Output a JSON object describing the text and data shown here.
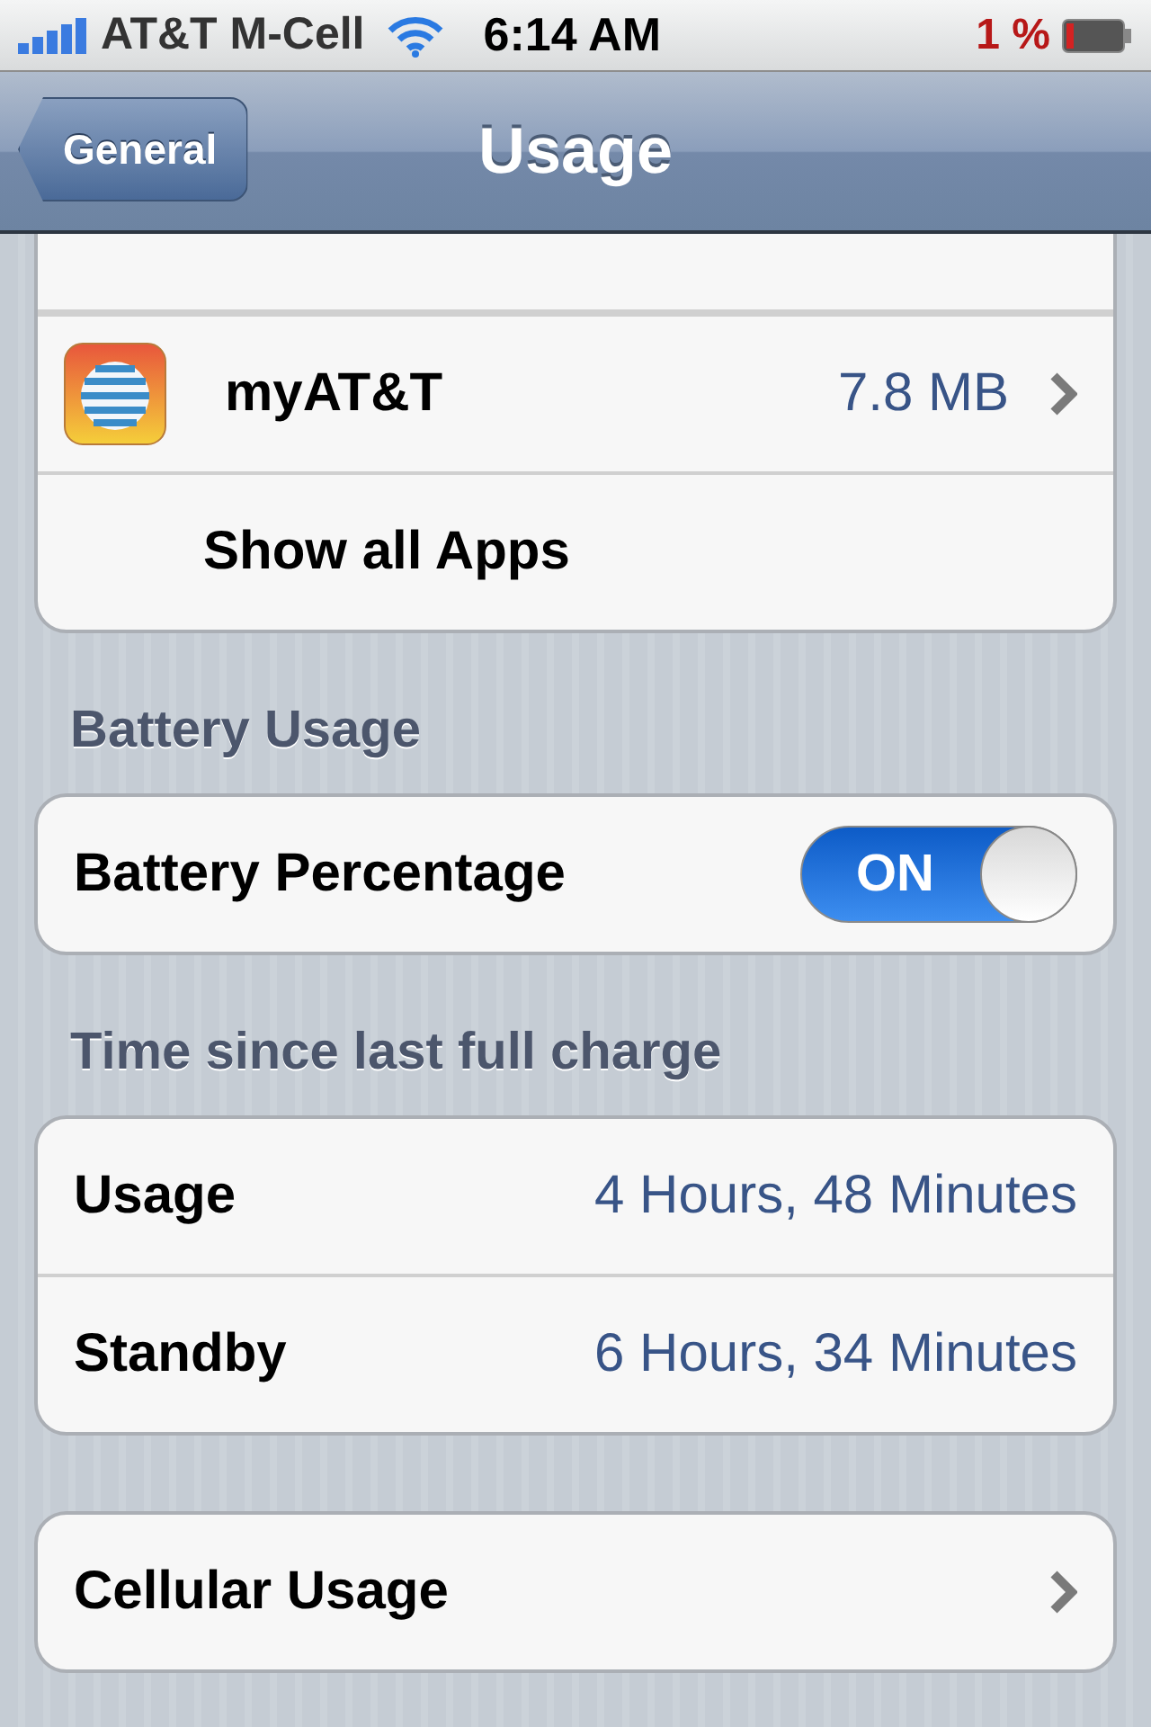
{
  "status_bar": {
    "carrier": "AT&T M-Cell",
    "time": "6:14 AM",
    "battery_percent": "1 %"
  },
  "nav_bar": {
    "back": "General",
    "title": "Usage"
  },
  "sections": [
    {
      "rows": [
        {
          "kind": "app",
          "label": "myAT&T",
          "value": "7.8 MB",
          "chevron": true
        },
        {
          "kind": "plain",
          "label": "Show all Apps"
        }
      ]
    },
    {
      "header": "Battery Usage",
      "rows": [
        {
          "kind": "toggle",
          "label": "Battery Percentage",
          "on": true,
          "toggle_text": "ON"
        }
      ]
    },
    {
      "header": "Time since last full charge",
      "rows": [
        {
          "kind": "value",
          "label": "Usage",
          "value": "4 Hours, 48 Minutes"
        },
        {
          "kind": "value",
          "label": "Standby",
          "value": "6 Hours, 34 Minutes"
        }
      ]
    },
    {
      "rows": [
        {
          "kind": "value",
          "label": "Cellular Usage",
          "chevron": true
        }
      ]
    }
  ]
}
